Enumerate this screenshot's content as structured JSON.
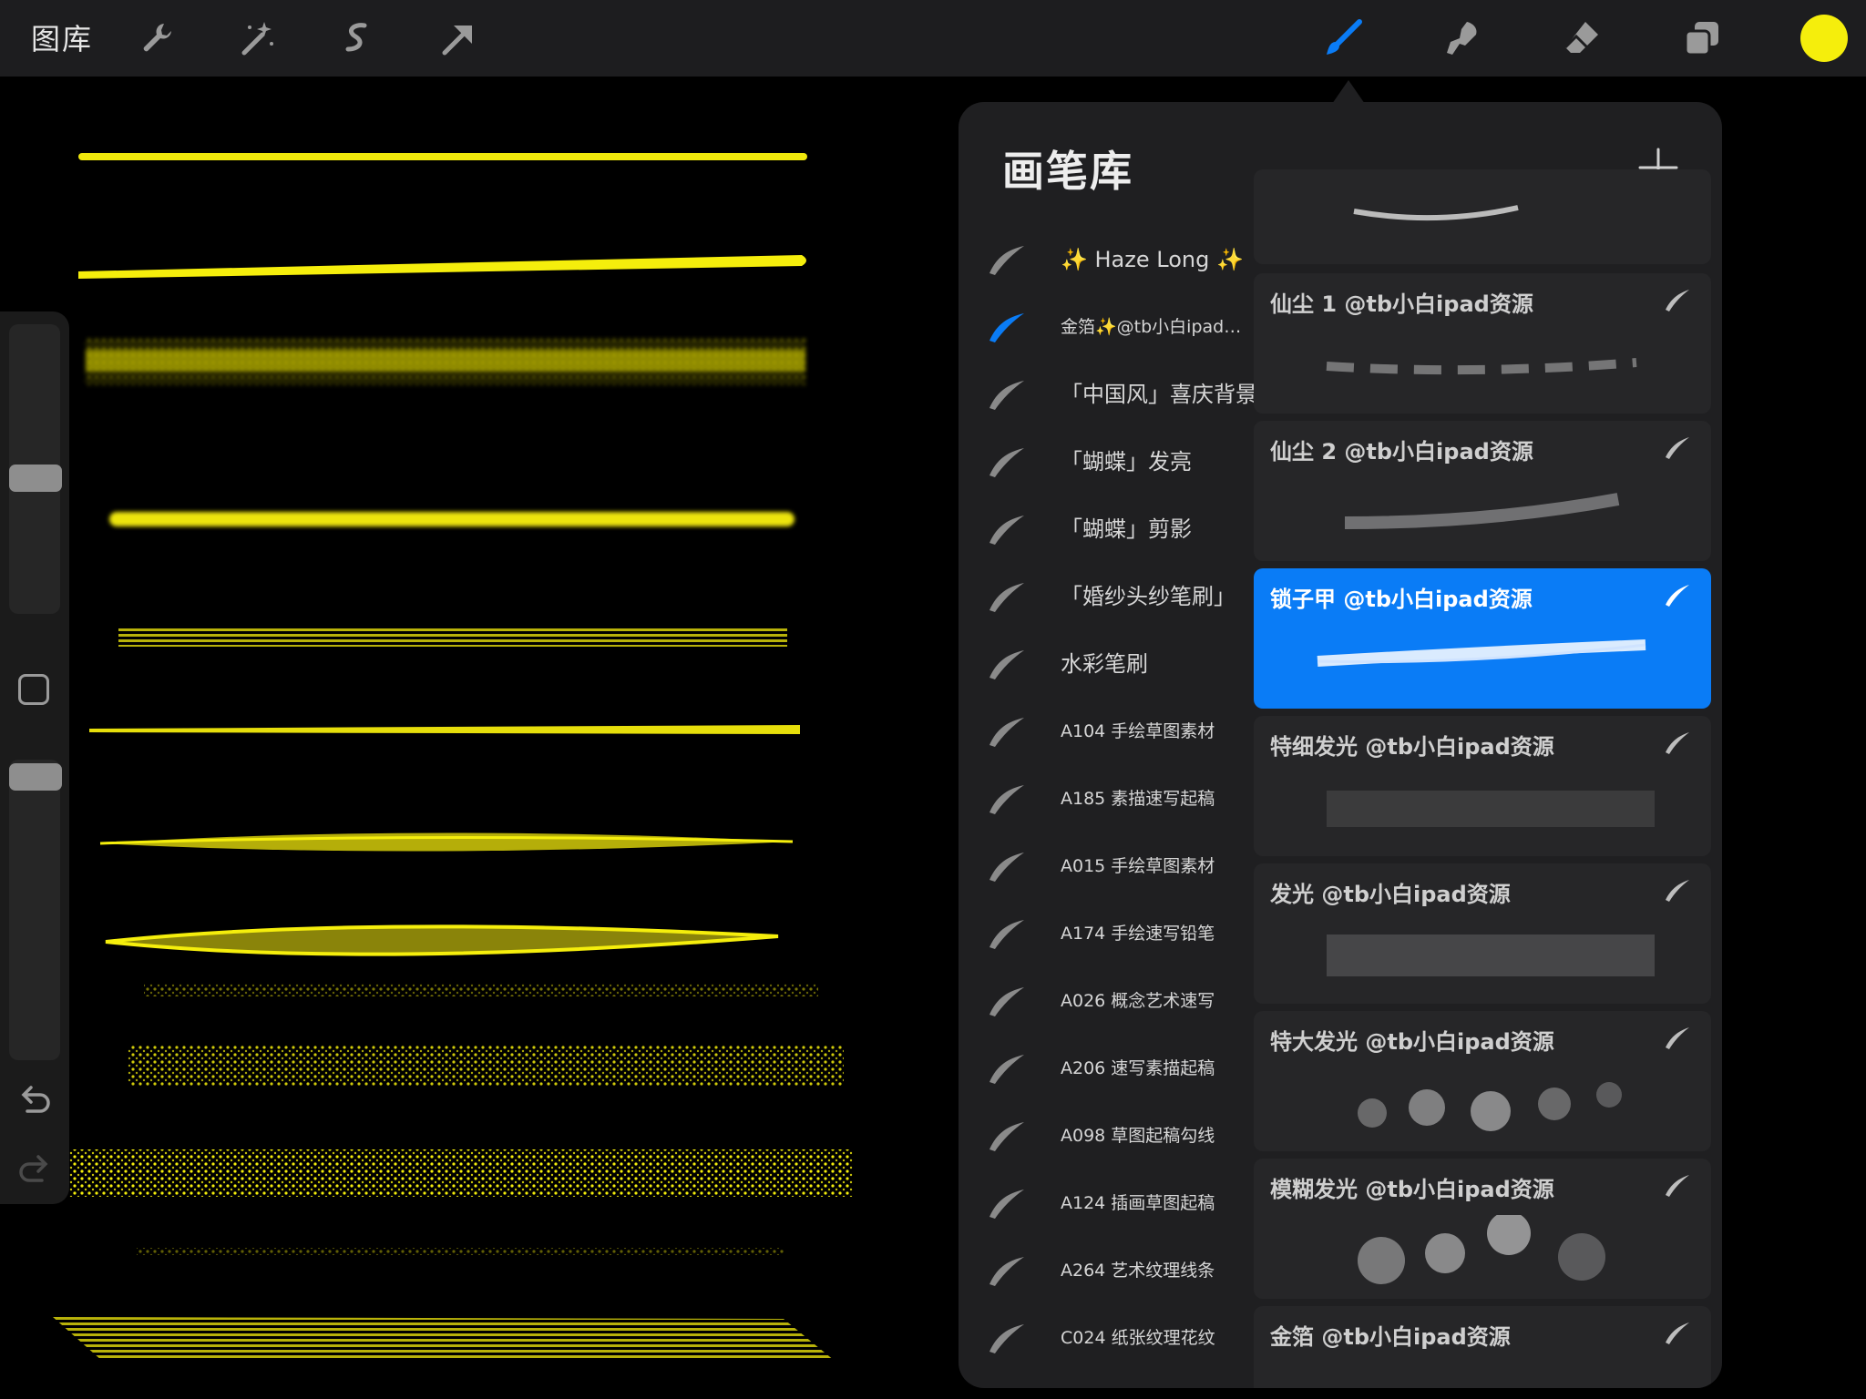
{
  "toolbar": {
    "gallery_label": "图库",
    "color": "#f5ee0c",
    "left_tools": [
      "wrench-icon",
      "magic-wand-icon",
      "selection-icon",
      "transform-arrow-icon"
    ],
    "right_tools": [
      "brush-icon",
      "smudge-icon",
      "eraser-icon",
      "layers-icon"
    ],
    "active_tool": "brush-icon"
  },
  "panel": {
    "title": "画笔库",
    "add_icon": "plus-icon",
    "sets": [
      {
        "label": "✨ Haze Long ✨",
        "active": false
      },
      {
        "label": "金箔✨@tb小白ipad资源",
        "active": true
      },
      {
        "label": "「中国风」喜庆背景",
        "active": false
      },
      {
        "label": "「蝴蝶」发亮",
        "active": false
      },
      {
        "label": "「蝴蝶」剪影",
        "active": false
      },
      {
        "label": "「婚纱头纱笔刷」",
        "active": false
      },
      {
        "label": "水彩笔刷",
        "active": false
      },
      {
        "label": "A104 手绘草图素材",
        "active": false
      },
      {
        "label": "A185 素描速写起稿",
        "active": false
      },
      {
        "label": "A015 手绘草图素材",
        "active": false
      },
      {
        "label": "A174 手绘速写铅笔",
        "active": false
      },
      {
        "label": "A026 概念艺术速写",
        "active": false
      },
      {
        "label": "A206 速写素描起稿",
        "active": false
      },
      {
        "label": "A098 草图起稿勾线",
        "active": false
      },
      {
        "label": "A124 插画草图起稿",
        "active": false
      },
      {
        "label": "A264 艺术纹理线条",
        "active": false
      },
      {
        "label": "C024 纸张纹理花纹",
        "active": false
      }
    ],
    "set_prefix_icons": {
      "pencil": "✏",
      "scroll": "📜"
    },
    "brushes": [
      {
        "name": "仙尘 1 @tb小白ipad资源",
        "selected": false
      },
      {
        "name": "仙尘 2 @tb小白ipad资源",
        "selected": false
      },
      {
        "name": "锁子甲 @tb小白ipad资源",
        "selected": true
      },
      {
        "name": "特细发光 @tb小白ipad资源",
        "selected": false
      },
      {
        "name": "发光 @tb小白ipad资源",
        "selected": false
      },
      {
        "name": "特大发光 @tb小白ipad资源",
        "selected": false
      },
      {
        "name": "模糊发光 @tb小白ipad资源",
        "selected": false
      },
      {
        "name": "金箔 @tb小白ipad资源",
        "selected": false
      }
    ],
    "accent": "#0a7cf6"
  },
  "sidebar": {
    "icons": [
      "undo-icon",
      "redo-icon"
    ]
  }
}
